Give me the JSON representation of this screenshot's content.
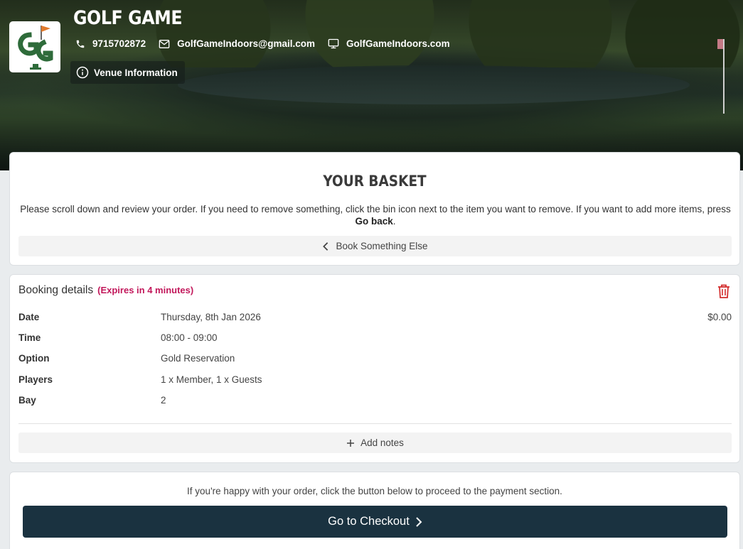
{
  "venue": {
    "name": "GOLF GAME",
    "phone": "9715702872",
    "email": "GolfGameIndoors@gmail.com",
    "website": "GolfGameIndoors.com",
    "info_label": "Venue Information",
    "logo_icon": "golf-flag-gg-logo"
  },
  "basket": {
    "title": "YOUR BASKET",
    "instructions_part1": "Please scroll down and review your order. If you need to remove something, click the bin icon next to the item you want to remove. If you want to add more items, press ",
    "instructions_bold": "Go back",
    "instructions_part2": ".",
    "book_else_label": "Book Something Else"
  },
  "booking": {
    "heading": "Booking details",
    "expires": "(Expires in 4 minutes)",
    "price": "$0.00",
    "rows": [
      {
        "label": "Date",
        "value": "Thursday, 8th Jan 2026"
      },
      {
        "label": "Time",
        "value": "08:00 - 09:00"
      },
      {
        "label": "Option",
        "value": "Gold Reservation"
      },
      {
        "label": "Players",
        "value": "1 x Member, 1 x Guests"
      },
      {
        "label": "Bay",
        "value": "2"
      }
    ],
    "add_notes_label": "Add notes"
  },
  "checkout": {
    "prompt": "If you're happy with your order, click the button below to proceed to the payment section.",
    "button_label": "Go to Checkout"
  },
  "colors": {
    "accent_dark": "#1a3240",
    "expiry_red": "#c2185b",
    "bin_red": "#d32f2f",
    "logo_green": "#2e6b3a",
    "logo_flag": "#e07a2c"
  }
}
